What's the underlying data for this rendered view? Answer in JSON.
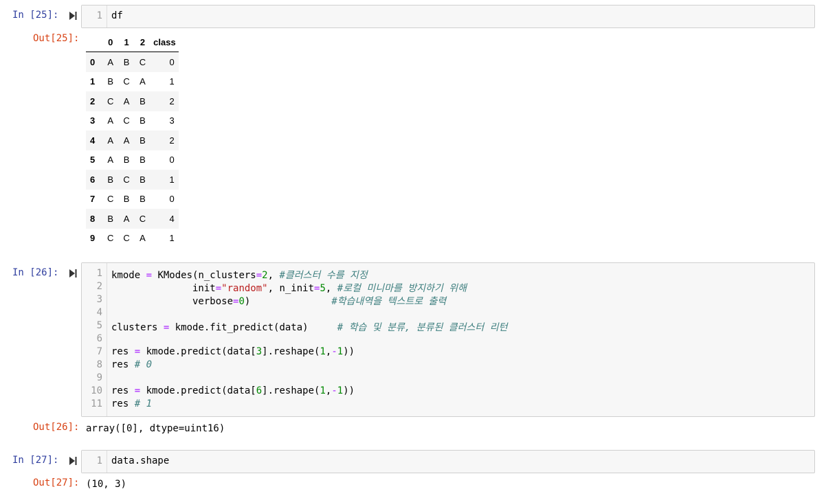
{
  "cells": {
    "c25": {
      "in_prompt": "In [25]:",
      "out_prompt": "Out[25]:",
      "line_nums": [
        "1"
      ],
      "code": "df",
      "table": {
        "columns": [
          "",
          "0",
          "1",
          "2",
          "class"
        ],
        "rows": [
          [
            "0",
            "A",
            "B",
            "C",
            "0"
          ],
          [
            "1",
            "B",
            "C",
            "A",
            "1"
          ],
          [
            "2",
            "C",
            "A",
            "B",
            "2"
          ],
          [
            "3",
            "A",
            "C",
            "B",
            "3"
          ],
          [
            "4",
            "A",
            "A",
            "B",
            "2"
          ],
          [
            "5",
            "A",
            "B",
            "B",
            "0"
          ],
          [
            "6",
            "B",
            "C",
            "B",
            "1"
          ],
          [
            "7",
            "C",
            "B",
            "B",
            "0"
          ],
          [
            "8",
            "B",
            "A",
            "C",
            "4"
          ],
          [
            "9",
            "C",
            "C",
            "A",
            "1"
          ]
        ]
      }
    },
    "c26": {
      "in_prompt": "In [26]:",
      "out_prompt": "Out[26]:",
      "line_nums": [
        "1",
        "2",
        "3",
        "4",
        "5",
        "6",
        "7",
        "8",
        "9",
        "10",
        "11"
      ],
      "lines": {
        "l1": {
          "a": "kmode ",
          "op1": "=",
          "b": " KModes(n_clusters",
          "op2": "=",
          "n1": "2",
          "c": ", ",
          "com": "#클러스터 수를 지정"
        },
        "l2": {
          "a": "              init",
          "op1": "=",
          "s1": "\"random\"",
          "b": ", n_init",
          "op2": "=",
          "n1": "5",
          "c": ", ",
          "com": "#로컬 미니마를 방지하기 위해"
        },
        "l3": {
          "a": "              verbose",
          "op1": "=",
          "n1": "0",
          "b": ")              ",
          "com": "#학습내역을 텍스트로 출력"
        },
        "l5": {
          "a": "clusters ",
          "op1": "=",
          "b": " kmode.fit_predict(data)     ",
          "com": "# 학습 및 분류, 분류된 클러스터 리턴"
        },
        "l7": {
          "a": "res ",
          "op1": "=",
          "b": " kmode.predict(data[",
          "n1": "3",
          "c": "].reshape(",
          "n2": "1",
          "d": ",",
          "op2": "-",
          "n3": "1",
          "e": "))"
        },
        "l8": {
          "a": "res ",
          "com": "# 0"
        },
        "l10": {
          "a": "res ",
          "op1": "=",
          "b": " kmode.predict(data[",
          "n1": "6",
          "c": "].reshape(",
          "n2": "1",
          "d": ",",
          "op2": "-",
          "n3": "1",
          "e": "))"
        },
        "l11": {
          "a": "res ",
          "com": "# 1"
        }
      },
      "output": "array([0], dtype=uint16)"
    },
    "c27": {
      "in_prompt": "In [27]:",
      "out_prompt": "Out[27]:",
      "line_nums": [
        "1"
      ],
      "code": "data.shape",
      "output": "(10, 3)"
    }
  },
  "icons": {
    "run": "run-cell-icon"
  },
  "colors": {
    "in_prompt": "#303f9f",
    "out_prompt": "#d84315",
    "keyword_op": "#aa22ff",
    "number": "#008800",
    "string": "#ba2121",
    "comment": "#408080"
  }
}
